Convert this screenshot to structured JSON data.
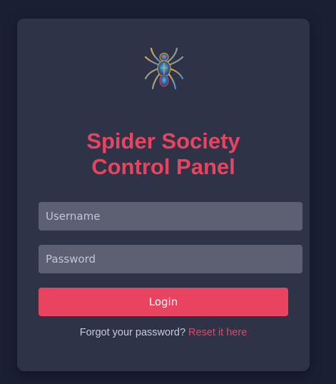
{
  "page": {
    "title_line1": "Spider Society",
    "title_line2": "Control Panel"
  },
  "logo": {
    "icon": "spider-logo-icon"
  },
  "form": {
    "username_placeholder": "Username",
    "username_value": "",
    "password_placeholder": "Password",
    "password_value": "",
    "login_label": "Login"
  },
  "footer": {
    "forgot_text": "Forgot your password?",
    "reset_link": "Reset it here"
  },
  "colors": {
    "background": "#1b1f33",
    "card": "#2f3347",
    "accent": "#e8445f",
    "input": "#5d6072"
  }
}
